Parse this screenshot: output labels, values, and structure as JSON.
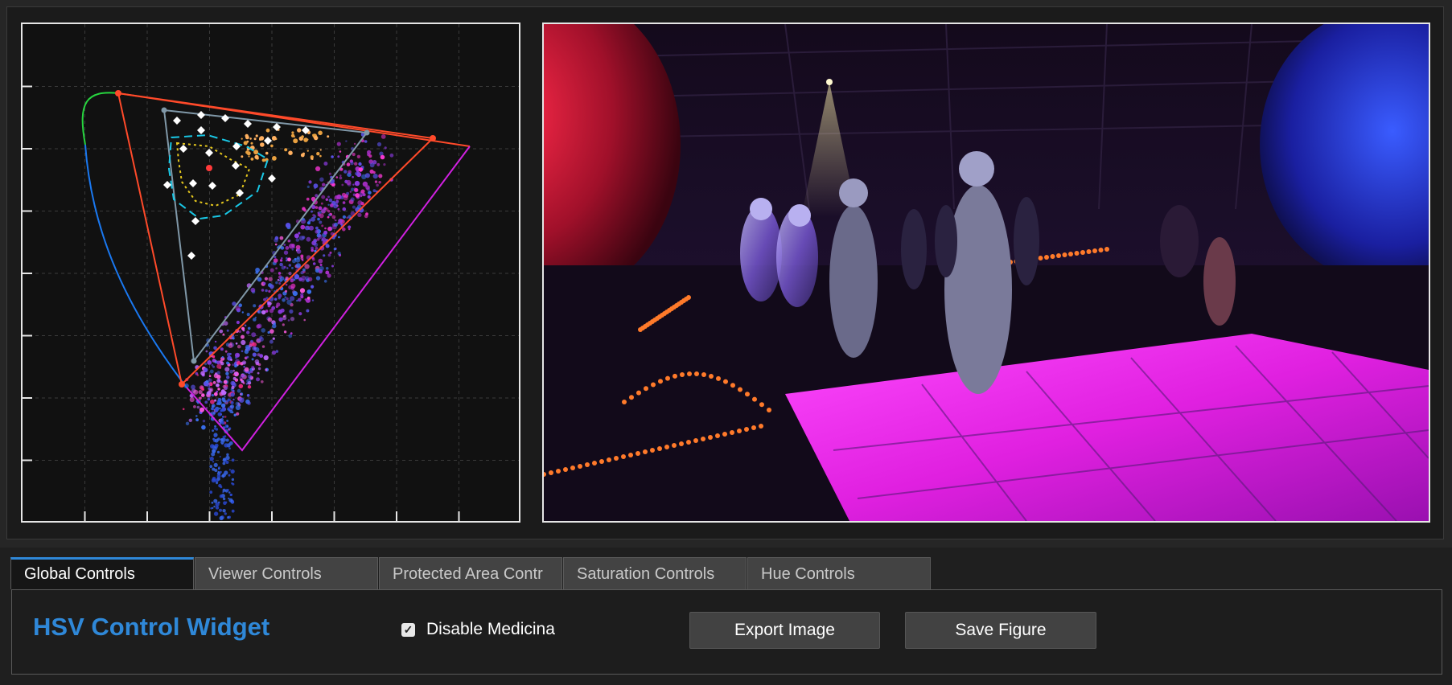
{
  "tabs": [
    {
      "label": "Global Controls",
      "active": true
    },
    {
      "label": "Viewer Controls",
      "active": false
    },
    {
      "label": "Protected Area Contr",
      "active": false
    },
    {
      "label": "Saturation Controls",
      "active": false
    },
    {
      "label": "Hue Controls",
      "active": false
    }
  ],
  "global_controls": {
    "title": "HSV Control Widget",
    "checkbox_label": "Disable Medicina",
    "checkbox_checked": true,
    "export_button": "Export Image",
    "save_button": "Save Figure"
  },
  "colors": {
    "accent": "#2f88d8",
    "gamut_red": "#ff4a2a",
    "gamut_grey": "#8098a8",
    "protected_cyan": "#19c8e6",
    "protected_yellow": "#e6c81e",
    "spectral_magenta": "#d020e0"
  },
  "chart_data": {
    "type": "scatter",
    "title": "",
    "xlabel": "",
    "ylabel": "",
    "x_ticks": 7,
    "y_ticks": 7,
    "grid": true
  },
  "viewer": {
    "image_subject": "photo-viewer"
  }
}
